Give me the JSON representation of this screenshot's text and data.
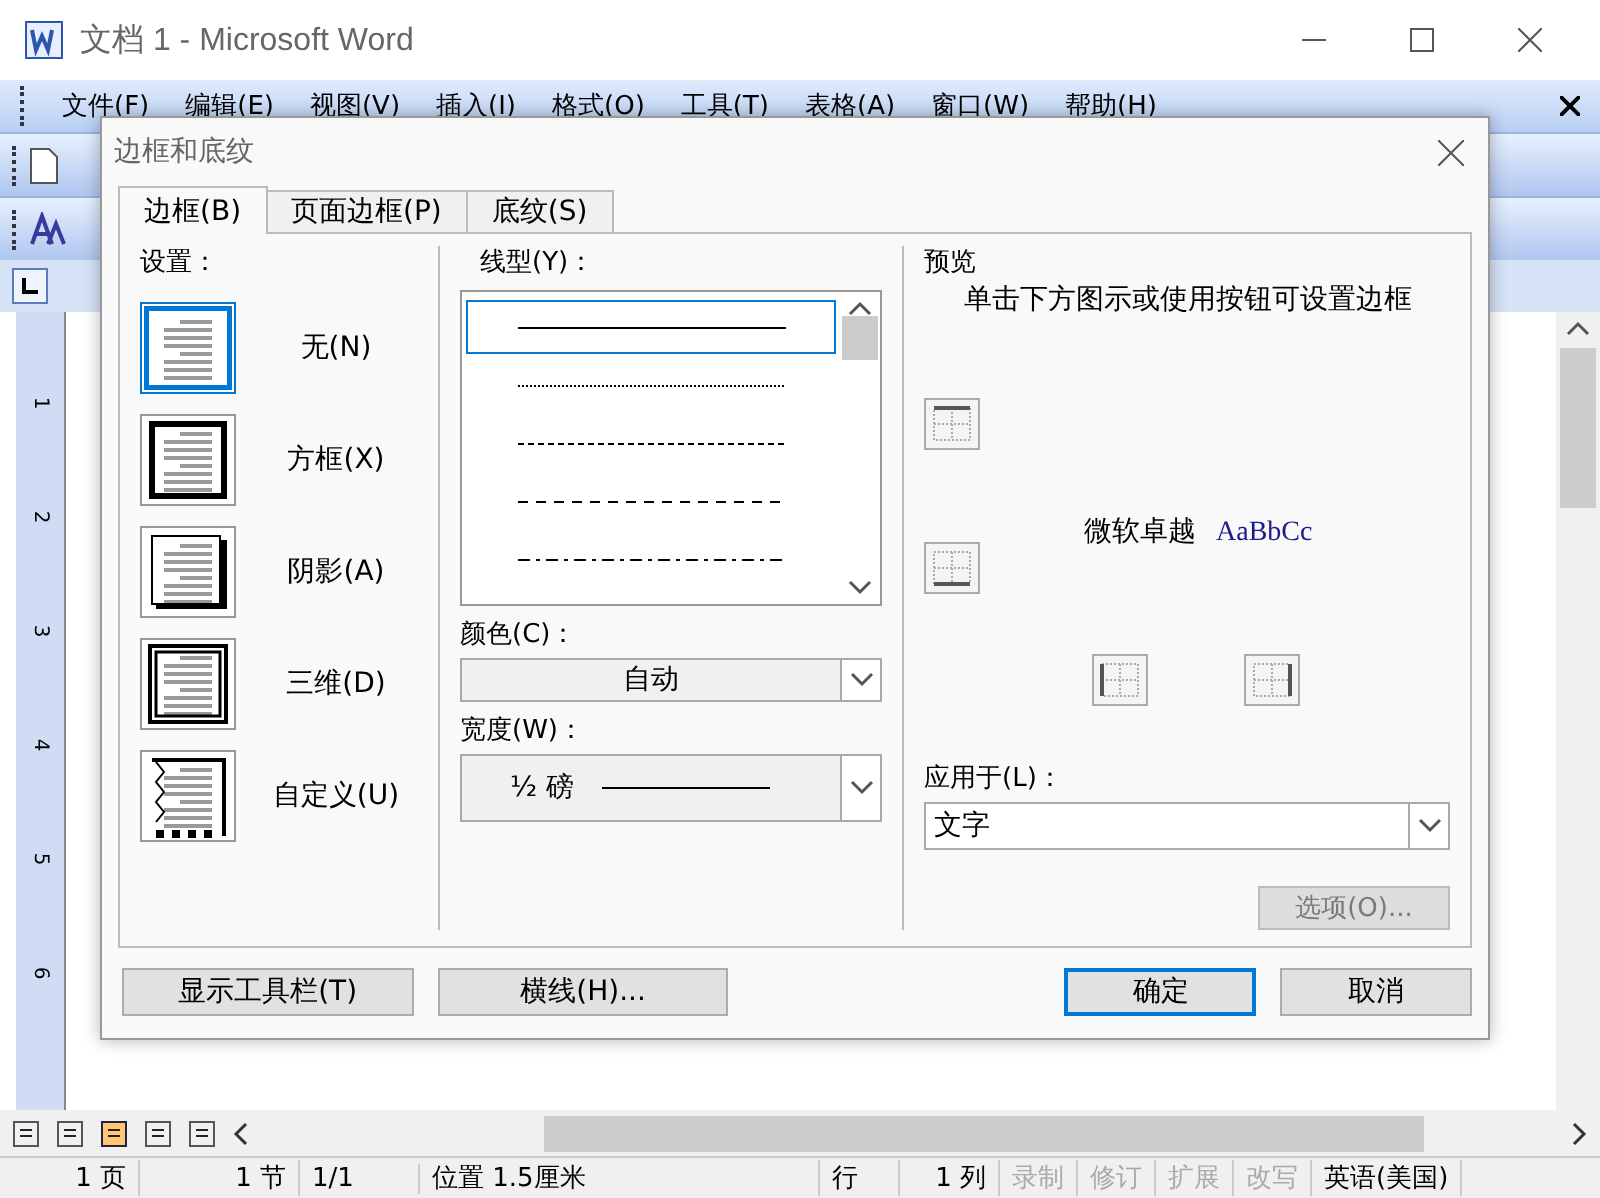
{
  "window": {
    "title": "文档 1 - Microsoft Word"
  },
  "menu": [
    "文件(F)",
    "编辑(E)",
    "视图(V)",
    "插入(I)",
    "格式(O)",
    "工具(T)",
    "表格(A)",
    "窗口(W)",
    "帮助(H)"
  ],
  "ruler_numbers": [
    "1",
    "2",
    "3",
    "4",
    "5",
    "6"
  ],
  "dialog": {
    "title": "边框和底纹",
    "tabs": [
      {
        "label": "边框(B)",
        "selected": true
      },
      {
        "label": "页面边框(P)",
        "selected": false
      },
      {
        "label": "底纹(S)",
        "selected": false
      }
    ],
    "settings_label": "设置：",
    "settings": [
      {
        "kind": "none",
        "label": "无(N)",
        "selected": true
      },
      {
        "kind": "box",
        "label": "方框(X)",
        "selected": false
      },
      {
        "kind": "shadow",
        "label": "阴影(A)",
        "selected": false
      },
      {
        "kind": "threed",
        "label": "三维(D)",
        "selected": false
      },
      {
        "kind": "custom",
        "label": "自定义(U)",
        "selected": false
      }
    ],
    "style_label": "线型(Y)：",
    "styles": [
      {
        "kind": "solid",
        "selected": true
      },
      {
        "kind": "dotted",
        "selected": false
      },
      {
        "kind": "dashed",
        "selected": false
      },
      {
        "kind": "longdash",
        "selected": false
      },
      {
        "kind": "dashdot",
        "selected": false
      }
    ],
    "color_label": "颜色(C)：",
    "color_value": "自动",
    "width_label": "宽度(W)：",
    "width_value": "½ 磅",
    "preview_label": "预览",
    "preview_hint": "单击下方图示或使用按钮可设置边框",
    "sample_cn": "微软卓越",
    "sample_en": "AaBbCc",
    "apply_label": "应用于(L)：",
    "apply_value": "文字",
    "options_button": {
      "label": "选项(O)...",
      "disabled": true
    },
    "buttons": [
      {
        "label": "显示工具栏(T)",
        "default": false
      },
      {
        "label": "横线(H)...",
        "default": false
      },
      {
        "label": "确定",
        "default": true
      },
      {
        "label": "取消",
        "default": false
      }
    ]
  },
  "status_bar": {
    "page": "1 页",
    "section": "1 节",
    "pages": "1/1",
    "position": "位置 1.5厘米",
    "line": "行",
    "column": "1 列",
    "modes": [
      {
        "label": "录制",
        "disabled": true
      },
      {
        "label": "修订",
        "disabled": true
      },
      {
        "label": "扩展",
        "disabled": true
      },
      {
        "label": "改写",
        "disabled": true
      }
    ],
    "language": "英语(美国)"
  }
}
